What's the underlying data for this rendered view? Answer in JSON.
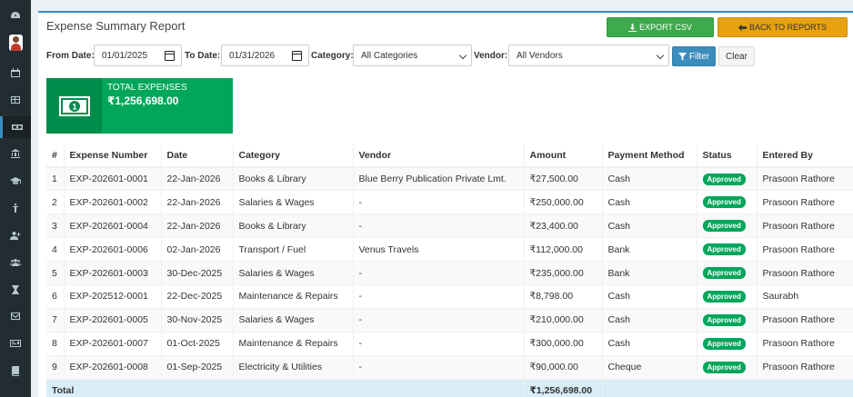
{
  "sidebar": {
    "icons": [
      "dashboard-icon",
      "user-avatar",
      "calendar-icon",
      "table-icon",
      "money-icon",
      "bank-icon",
      "graduation-cap-icon",
      "child-icon",
      "user-plus-icon",
      "users-icon",
      "hourglass-icon",
      "envelope-icon",
      "id-card-icon",
      "book-icon"
    ],
    "active": "money-icon"
  },
  "report": {
    "title": "Expense Summary Report",
    "export_label": "EXPORT CSV",
    "back_label": "BACK TO REPORTS"
  },
  "filters": {
    "from_label": "From Date:",
    "from_value": "01/01/2025",
    "to_label": "To Date:",
    "to_value": "01/31/2026",
    "category_label": "Category:",
    "category_value": "All Categories",
    "vendor_label": "Vendor:",
    "vendor_value": "All Vendors",
    "filter_label": "Filter",
    "clear_label": "Clear"
  },
  "summary": {
    "label": "TOTAL EXPENSES",
    "value": "₹1,256,698.00"
  },
  "table": {
    "headers": [
      "#",
      "Expense Number",
      "Date",
      "Category",
      "Vendor",
      "Amount",
      "Payment Method",
      "Status",
      "Entered By"
    ],
    "rows": [
      [
        "1",
        "EXP-202601-0001",
        "22-Jan-2026",
        "Books & Library",
        "Blue Berry Publication Private Lmt.",
        "₹27,500.00",
        "Cash",
        "Approved",
        "Prasoon Rathore"
      ],
      [
        "2",
        "EXP-202601-0002",
        "22-Jan-2026",
        "Salaries & Wages",
        "-",
        "₹250,000.00",
        "Cash",
        "Approved",
        "Prasoon Rathore"
      ],
      [
        "3",
        "EXP-202601-0004",
        "22-Jan-2026",
        "Books & Library",
        "-",
        "₹23,400.00",
        "Cash",
        "Approved",
        "Prasoon Rathore"
      ],
      [
        "4",
        "EXP-202601-0006",
        "02-Jan-2026",
        "Transport / Fuel",
        "Venus Travels",
        "₹112,000.00",
        "Bank",
        "Approved",
        "Prasoon Rathore"
      ],
      [
        "5",
        "EXP-202601-0003",
        "30-Dec-2025",
        "Salaries & Wages",
        "-",
        "₹235,000.00",
        "Bank",
        "Approved",
        "Prasoon Rathore"
      ],
      [
        "6",
        "EXP-202512-0001",
        "22-Dec-2025",
        "Maintenance & Repairs",
        "-",
        "₹8,798.00",
        "Cash",
        "Approved",
        "Saurabh"
      ],
      [
        "7",
        "EXP-202601-0005",
        "30-Nov-2025",
        "Salaries & Wages",
        "-",
        "₹210,000.00",
        "Cash",
        "Approved",
        "Prasoon Rathore"
      ],
      [
        "8",
        "EXP-202601-0007",
        "01-Oct-2025",
        "Maintenance & Repairs",
        "-",
        "₹300,000.00",
        "Cash",
        "Approved",
        "Prasoon Rathore"
      ],
      [
        "9",
        "EXP-202601-0008",
        "01-Sep-2025",
        "Electricity & Utilities",
        "-",
        "₹90,000.00",
        "Cheque",
        "Approved",
        "Prasoon Rathore"
      ]
    ],
    "total_label": "Total",
    "total_value": "₹1,256,698.00"
  },
  "colors": {
    "sidebar_bg": "#222d32",
    "primary": "#3c8dbc",
    "success": "#00a65a",
    "warning": "#e8a20f"
  }
}
